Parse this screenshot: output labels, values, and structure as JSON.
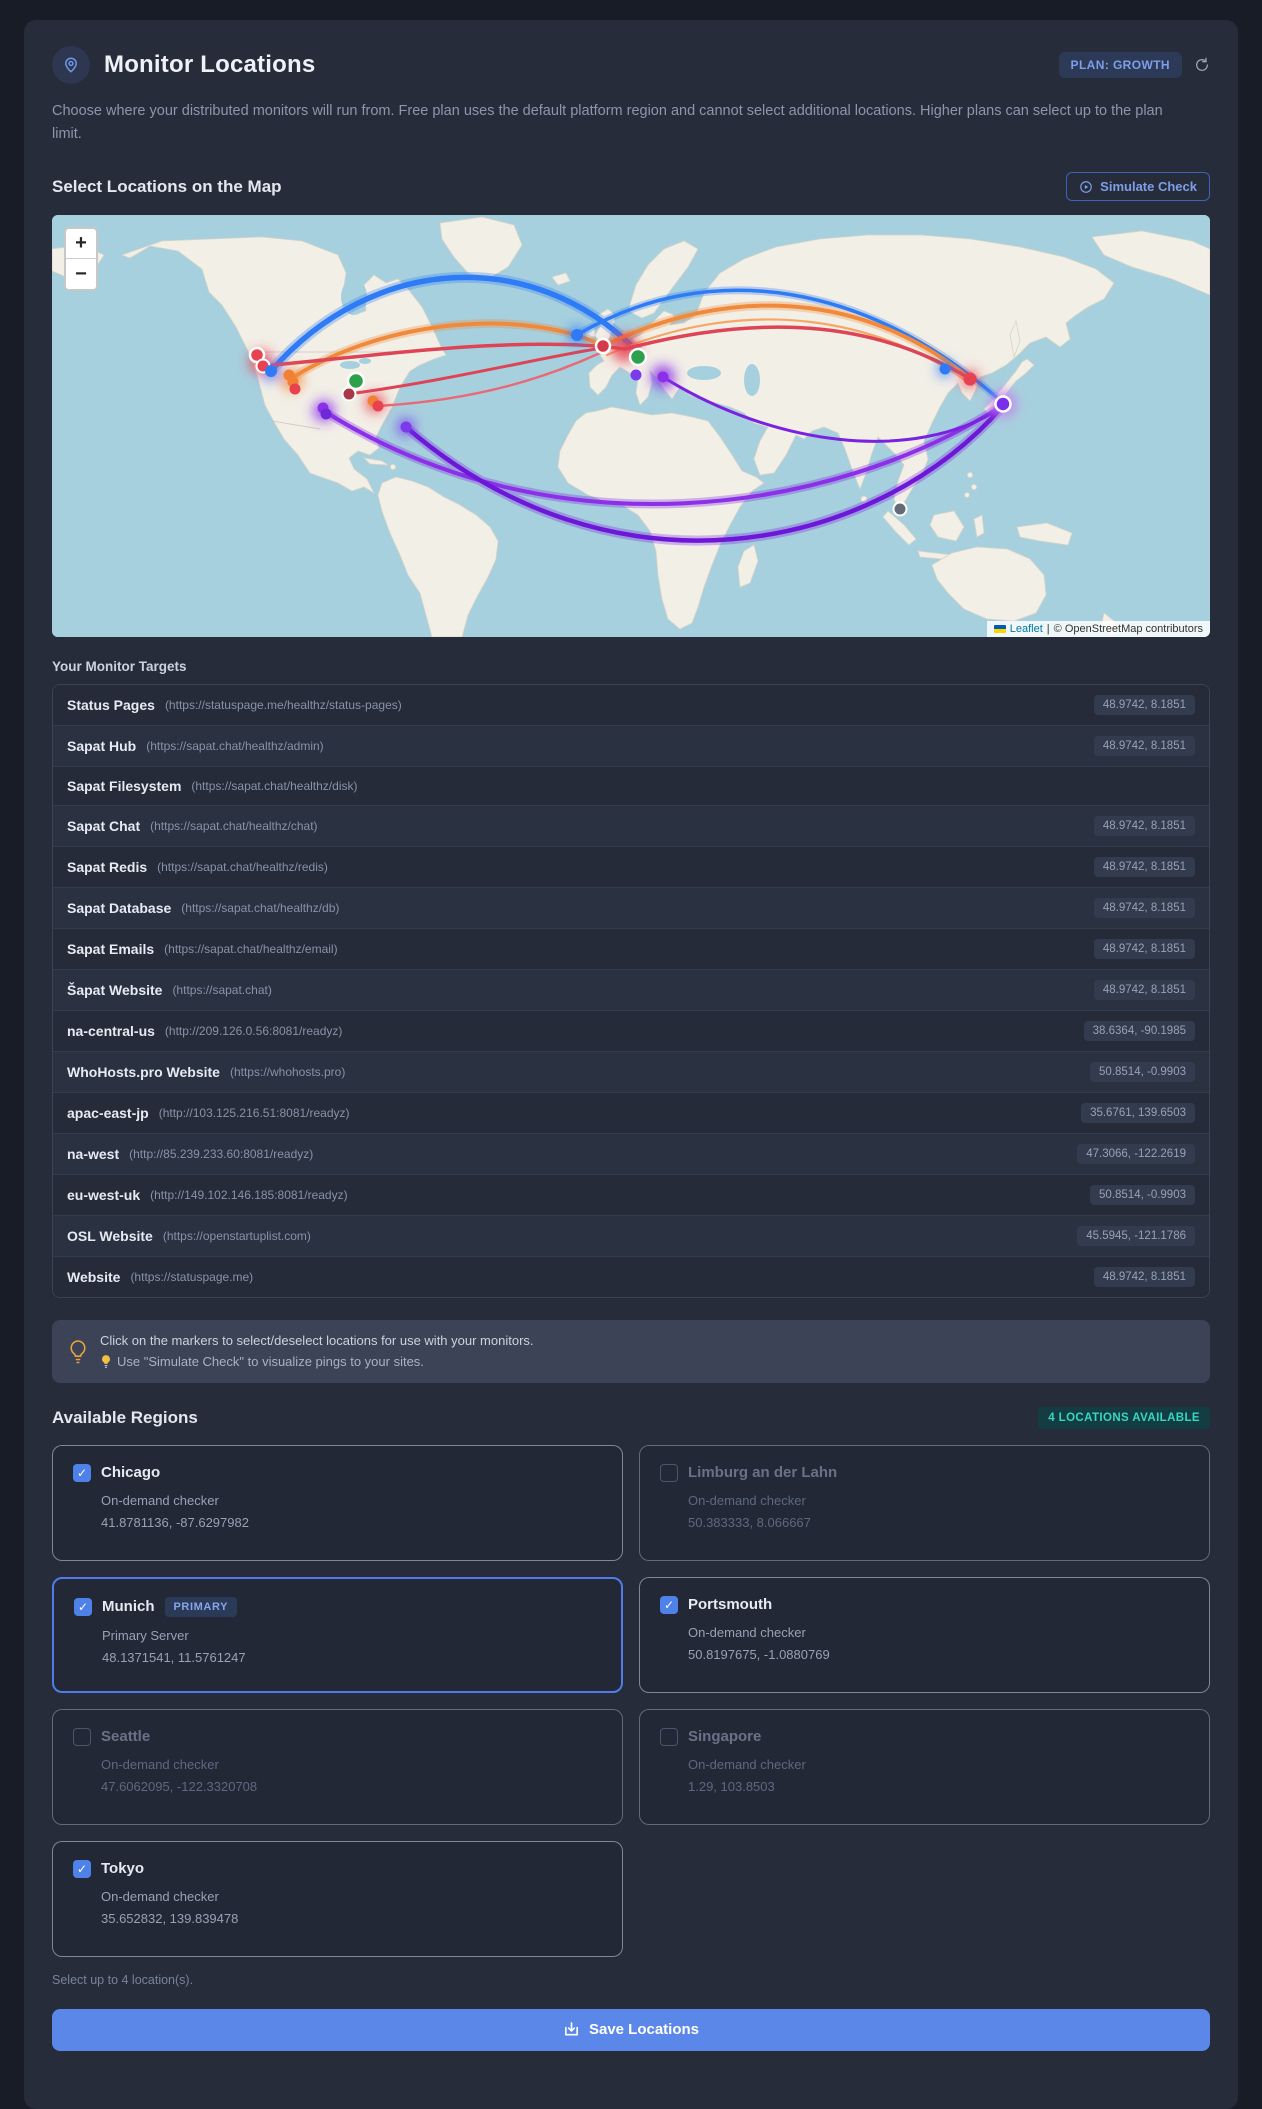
{
  "header": {
    "title": "Monitor Locations",
    "plan_badge": "PLAN: GROWTH",
    "description": "Choose where your distributed monitors will run from. Free plan uses the default platform region and cannot select additional locations. Higher plans can select up to the plan limit."
  },
  "map_section": {
    "heading": "Select Locations on the Map",
    "simulate_button": "Simulate Check",
    "zoom_in": "+",
    "zoom_out": "−",
    "attribution": {
      "leaflet": "Leaflet",
      "separator": "|",
      "osm": "© OpenStreetMap contributors"
    }
  },
  "targets": {
    "heading": "Your Monitor Targets",
    "rows": [
      {
        "name": "Status Pages",
        "url": "(https://statuspage.me/healthz/status-pages)",
        "coords": "48.9742, 8.1851"
      },
      {
        "name": "Sapat Hub",
        "url": "(https://sapat.chat/healthz/admin)",
        "coords": "48.9742, 8.1851"
      },
      {
        "name": "Sapat Filesystem",
        "url": "(https://sapat.chat/healthz/disk)",
        "coords": null
      },
      {
        "name": "Sapat Chat",
        "url": "(https://sapat.chat/healthz/chat)",
        "coords": "48.9742, 8.1851"
      },
      {
        "name": "Sapat Redis",
        "url": "(https://sapat.chat/healthz/redis)",
        "coords": "48.9742, 8.1851"
      },
      {
        "name": "Sapat Database",
        "url": "(https://sapat.chat/healthz/db)",
        "coords": "48.9742, 8.1851"
      },
      {
        "name": "Sapat Emails",
        "url": "(https://sapat.chat/healthz/email)",
        "coords": "48.9742, 8.1851"
      },
      {
        "name": "Šapat Website",
        "url": "(https://sapat.chat)",
        "coords": "48.9742, 8.1851"
      },
      {
        "name": "na-central-us",
        "url": "(http://209.126.0.56:8081/readyz)",
        "coords": "38.6364, -90.1985"
      },
      {
        "name": "WhoHosts.pro Website",
        "url": "(https://whohosts.pro)",
        "coords": "50.8514, -0.9903"
      },
      {
        "name": "apac-east-jp",
        "url": "(http://103.125.216.51:8081/readyz)",
        "coords": "35.6761, 139.6503"
      },
      {
        "name": "na-west",
        "url": "(http://85.239.233.60:8081/readyz)",
        "coords": "47.3066, -122.2619"
      },
      {
        "name": "eu-west-uk",
        "url": "(http://149.102.146.185:8081/readyz)",
        "coords": "50.8514, -0.9903"
      },
      {
        "name": "OSL Website",
        "url": "(https://openstartuplist.com)",
        "coords": "45.5945, -121.1786"
      },
      {
        "name": "Website",
        "url": "(https://statuspage.me)",
        "coords": "48.9742, 8.1851"
      }
    ]
  },
  "tip": {
    "line1": "Click on the markers to select/deselect locations for use with your monitors.",
    "line2": "Use \"Simulate Check\" to visualize pings to your sites."
  },
  "regions": {
    "heading": "Available Regions",
    "badge": "4 LOCATIONS AVAILABLE",
    "cards": [
      {
        "name": "Chicago",
        "sub": "On-demand checker",
        "coords": "41.8781136, -87.6297982"
      },
      {
        "name": "Limburg an der Lahn",
        "sub": "On-demand checker",
        "coords": "50.383333, 8.066667"
      },
      {
        "name": "Munich",
        "badge": "PRIMARY",
        "sub": "Primary Server",
        "coords": "48.1371541, 11.5761247"
      },
      {
        "name": "Portsmouth",
        "sub": "On-demand checker",
        "coords": "50.8197675, -1.0880769"
      },
      {
        "name": "Seattle",
        "sub": "On-demand checker",
        "coords": "47.6062095, -122.3320708"
      },
      {
        "name": "Singapore",
        "sub": "On-demand checker",
        "coords": "1.29, 103.8503"
      },
      {
        "name": "Tokyo",
        "sub": "On-demand checker",
        "coords": "35.652832, 139.839478"
      }
    ],
    "footnote": "Select up to 4 location(s)."
  },
  "save_button": "Save Locations",
  "colors": {
    "accent_blue": "#5b87e8",
    "teal_badge": "#36d6c0",
    "map_water": "#a7d0de",
    "map_land": "#f2efe7",
    "arc_blue": "#2e7bf6",
    "arc_orange": "#f08a3a",
    "arc_red": "#dd4455",
    "arc_purple": "#7a22e0",
    "marker_green": "#2ca04a",
    "marker_gray": "#636b78"
  }
}
